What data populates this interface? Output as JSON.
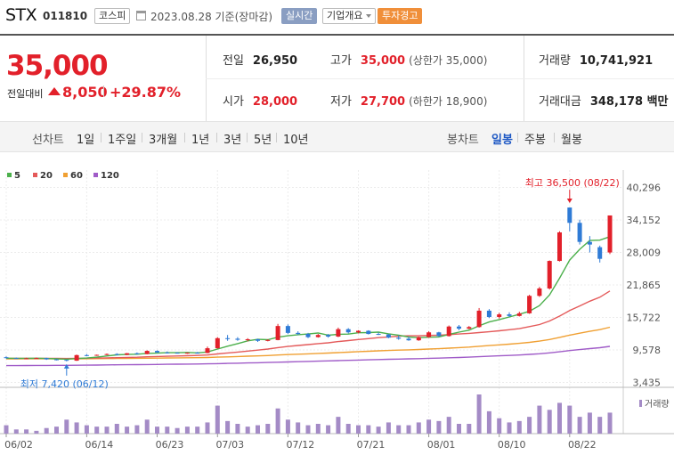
{
  "header": {
    "stock_name": "STX",
    "stock_code": "011810",
    "market_badge": "코스피",
    "date_text": "2023.08.28  기준(장마감)",
    "realtime_label": "실시간",
    "company_info_label": "기업개요",
    "warning_label": "투자경고"
  },
  "price": {
    "current": "35,000",
    "change_label": "전일대비",
    "change_value": "8,050",
    "change_pct": "+29.87%",
    "change_direction": "up",
    "prev_close_label": "전일",
    "prev_close": "26,950",
    "open_label": "시가",
    "open": "28,000",
    "high_label": "고가",
    "high": "35,000",
    "high_note": "(상한가 35,000)",
    "low_label": "저가",
    "low": "27,700",
    "low_note": "(하한가 18,900)",
    "volume_label": "거래량",
    "volume": "10,741,921",
    "amount_label": "거래대금",
    "amount": "348,178 백만"
  },
  "period_bar": {
    "line_chart_label": "선차트",
    "line_periods": [
      "1일",
      "1주일",
      "3개월",
      "1년",
      "3년",
      "5년",
      "10년"
    ],
    "candle_label": "봉차트",
    "candle_periods": [
      "일봉",
      "주봉",
      "월봉"
    ],
    "selected_candle": "일봉"
  },
  "colors": {
    "up": "#e2202a",
    "down": "#2f7bd6",
    "ma5": "#4cb04c",
    "ma20": "#e45a5a",
    "ma60": "#f0a033",
    "ma120": "#a05cc8",
    "volume": "#a48bc6"
  },
  "chart_data": {
    "type": "candlestick",
    "legend": [
      {
        "name": "5",
        "color": "#4cb04c"
      },
      {
        "name": "20",
        "color": "#e45a5a"
      },
      {
        "name": "60",
        "color": "#f0a033"
      },
      {
        "name": "120",
        "color": "#a05cc8"
      }
    ],
    "y_ticks": [
      "40,296",
      "34,152",
      "28,009",
      "21,865",
      "15,722",
      "9,578",
      "3,435"
    ],
    "ylim": [
      3435,
      40296
    ],
    "x_ticks": [
      "06/02",
      "06/14",
      "06/23",
      "07/03",
      "07/12",
      "07/21",
      "08/01",
      "08/10",
      "08/22"
    ],
    "x_tick_index": [
      0,
      8,
      15,
      21,
      28,
      35,
      42,
      49,
      56
    ],
    "annotations": {
      "high_text": "최고 36,500 (08/22)",
      "low_text": "최저 7,420 (06/12)",
      "high_index": 56,
      "low_index": 6
    },
    "volume_label": "거래량",
    "candles": [
      [
        8200,
        8350,
        7950,
        8050
      ],
      [
        8050,
        8150,
        7900,
        7950
      ],
      [
        7950,
        8100,
        7850,
        8000
      ],
      [
        8000,
        8150,
        7900,
        8050
      ],
      [
        8050,
        8100,
        7700,
        7800
      ],
      [
        7800,
        7900,
        7600,
        7700
      ],
      [
        7700,
        7750,
        7420,
        7550
      ],
      [
        7550,
        8700,
        7500,
        8600
      ],
      [
        8600,
        8800,
        8400,
        8550
      ],
      [
        8550,
        8700,
        8450,
        8650
      ],
      [
        8650,
        8900,
        8600,
        8800
      ],
      [
        8800,
        8950,
        8550,
        8650
      ],
      [
        8650,
        9000,
        8600,
        8950
      ],
      [
        8950,
        9100,
        8700,
        8800
      ],
      [
        8800,
        9500,
        8750,
        9400
      ],
      [
        9400,
        9500,
        9000,
        9100
      ],
      [
        9100,
        9300,
        8900,
        9050
      ],
      [
        9050,
        9150,
        8900,
        8950
      ],
      [
        8950,
        9100,
        8850,
        9050
      ],
      [
        9050,
        9200,
        8900,
        9000
      ],
      [
        9000,
        10200,
        8950,
        9900
      ],
      [
        9900,
        12000,
        9800,
        11800
      ],
      [
        11800,
        12400,
        11300,
        11700
      ],
      [
        11700,
        12000,
        11300,
        11500
      ],
      [
        11500,
        11800,
        11200,
        11600
      ],
      [
        11600,
        11700,
        11100,
        11300
      ],
      [
        11300,
        11600,
        11200,
        11450
      ],
      [
        11450,
        14500,
        11400,
        14100
      ],
      [
        14100,
        14400,
        12600,
        12800
      ],
      [
        12800,
        13100,
        12400,
        12600
      ],
      [
        12600,
        12800,
        11800,
        12000
      ],
      [
        12000,
        12600,
        11900,
        12400
      ],
      [
        12400,
        12600,
        11900,
        12100
      ],
      [
        12100,
        13800,
        12000,
        13500
      ],
      [
        13500,
        13700,
        12700,
        12900
      ],
      [
        12900,
        13300,
        12700,
        13200
      ],
      [
        13200,
        13300,
        12500,
        12600
      ],
      [
        12600,
        12900,
        12400,
        12500
      ],
      [
        12500,
        12600,
        11800,
        11900
      ],
      [
        11900,
        12300,
        11500,
        11700
      ],
      [
        11700,
        12100,
        11300,
        11400
      ],
      [
        11400,
        12100,
        11300,
        12000
      ],
      [
        12000,
        13100,
        11900,
        12900
      ],
      [
        12900,
        13000,
        12100,
        12200
      ],
      [
        12200,
        14200,
        12100,
        14000
      ],
      [
        14000,
        14300,
        13300,
        13600
      ],
      [
        13600,
        14100,
        13500,
        13900
      ],
      [
        13900,
        17500,
        13800,
        17000
      ],
      [
        17000,
        17300,
        15600,
        15800
      ],
      [
        15800,
        16600,
        15500,
        16300
      ],
      [
        16300,
        16700,
        15800,
        16000
      ],
      [
        16000,
        16800,
        15900,
        16500
      ],
      [
        16500,
        20000,
        16400,
        19800
      ],
      [
        19800,
        21500,
        19600,
        21200
      ],
      [
        21200,
        26500,
        21000,
        26400
      ],
      [
        26400,
        32000,
        26300,
        31800
      ],
      [
        36500,
        36500,
        32000,
        33600
      ],
      [
        33600,
        34200,
        29500,
        30000
      ],
      [
        30000,
        31100,
        28000,
        29500
      ],
      [
        29000,
        29300,
        26100,
        26800
      ],
      [
        28000,
        35000,
        27700,
        35000
      ]
    ],
    "volumes": [
      6,
      3,
      3,
      2,
      4,
      5,
      10,
      8,
      6,
      5,
      5,
      7,
      5,
      6,
      10,
      5,
      5,
      4,
      5,
      5,
      8,
      20,
      9,
      7,
      5,
      6,
      7,
      18,
      10,
      8,
      6,
      7,
      6,
      12,
      7,
      6,
      6,
      5,
      8,
      6,
      6,
      8,
      10,
      9,
      12,
      7,
      7,
      28,
      16,
      11,
      8,
      9,
      12,
      20,
      17,
      22,
      20,
      12,
      15,
      12,
      15
    ]
  }
}
